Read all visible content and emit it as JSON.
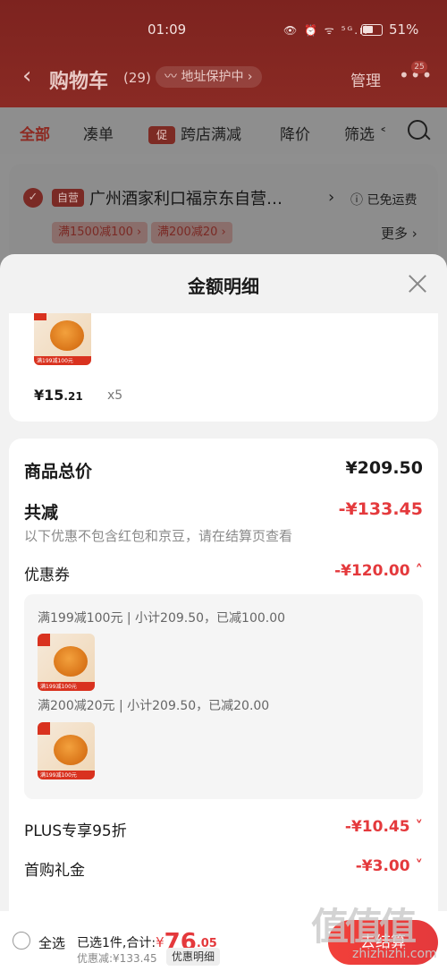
{
  "status_bar": {
    "time": "01:09",
    "icons": "👁 ⏰ ᯤ ⁵ᴳ.ıl",
    "battery": "51%"
  },
  "header": {
    "back": "‹",
    "title": "购物车",
    "count": "(29)",
    "address": "〰 地址保护中 ›",
    "manage": "管理",
    "more": "•••",
    "badge": "25"
  },
  "tabs": [
    {
      "label": "全部"
    },
    {
      "label": "凑单"
    },
    {
      "tag": "促",
      "label": "跨店满减"
    },
    {
      "label": "降价"
    },
    {
      "label": "筛选 ˂"
    }
  ],
  "store": {
    "check": "✓",
    "self_tag": "自营",
    "name": "广州酒家利口福京东自营…",
    "arrow": "›",
    "free_shipping": "ⓘ 已免运费",
    "promos": [
      "满1500减100 ›",
      "满200减20 ›"
    ],
    "more": "更多 ›"
  },
  "sheet": {
    "title": "金额明细",
    "item": {
      "price_main": "¥15",
      "price_dec": ".21",
      "qty": "x5",
      "thumb_text": "满199减100元"
    },
    "summary": {
      "total_label": "商品总价",
      "total_value": "¥209.50",
      "reduce_label": "共减",
      "reduce_value": "-¥133.45",
      "reduce_note": "以下优惠不包含红包和京豆，请在结算页查看",
      "coupon_label": "优惠券",
      "coupon_value": "-¥120.00 ˄",
      "coupon_lines": [
        "满199减100元 | 小计209.50，已减100.00",
        "满200减20元 | 小计209.50，已减20.00"
      ],
      "plus_label": "PLUS专享95折",
      "plus_value": "-¥10.45 ˅",
      "first_label": "首购礼金",
      "first_value": "-¥3.00 ˅"
    }
  },
  "bottom": {
    "select_all": "全选",
    "selected": "已选1件,合计:",
    "currency": "¥",
    "amount": "76",
    "amount_dec": ".05",
    "discount": "优惠减:¥133.45",
    "detail_button": "优惠明细",
    "checkout": "去结算"
  },
  "watermark": {
    "big": "值值值",
    "small": "zhizhizhi.com"
  },
  "colors": {
    "accent": "#e4393c",
    "header": "#8a2a24"
  }
}
